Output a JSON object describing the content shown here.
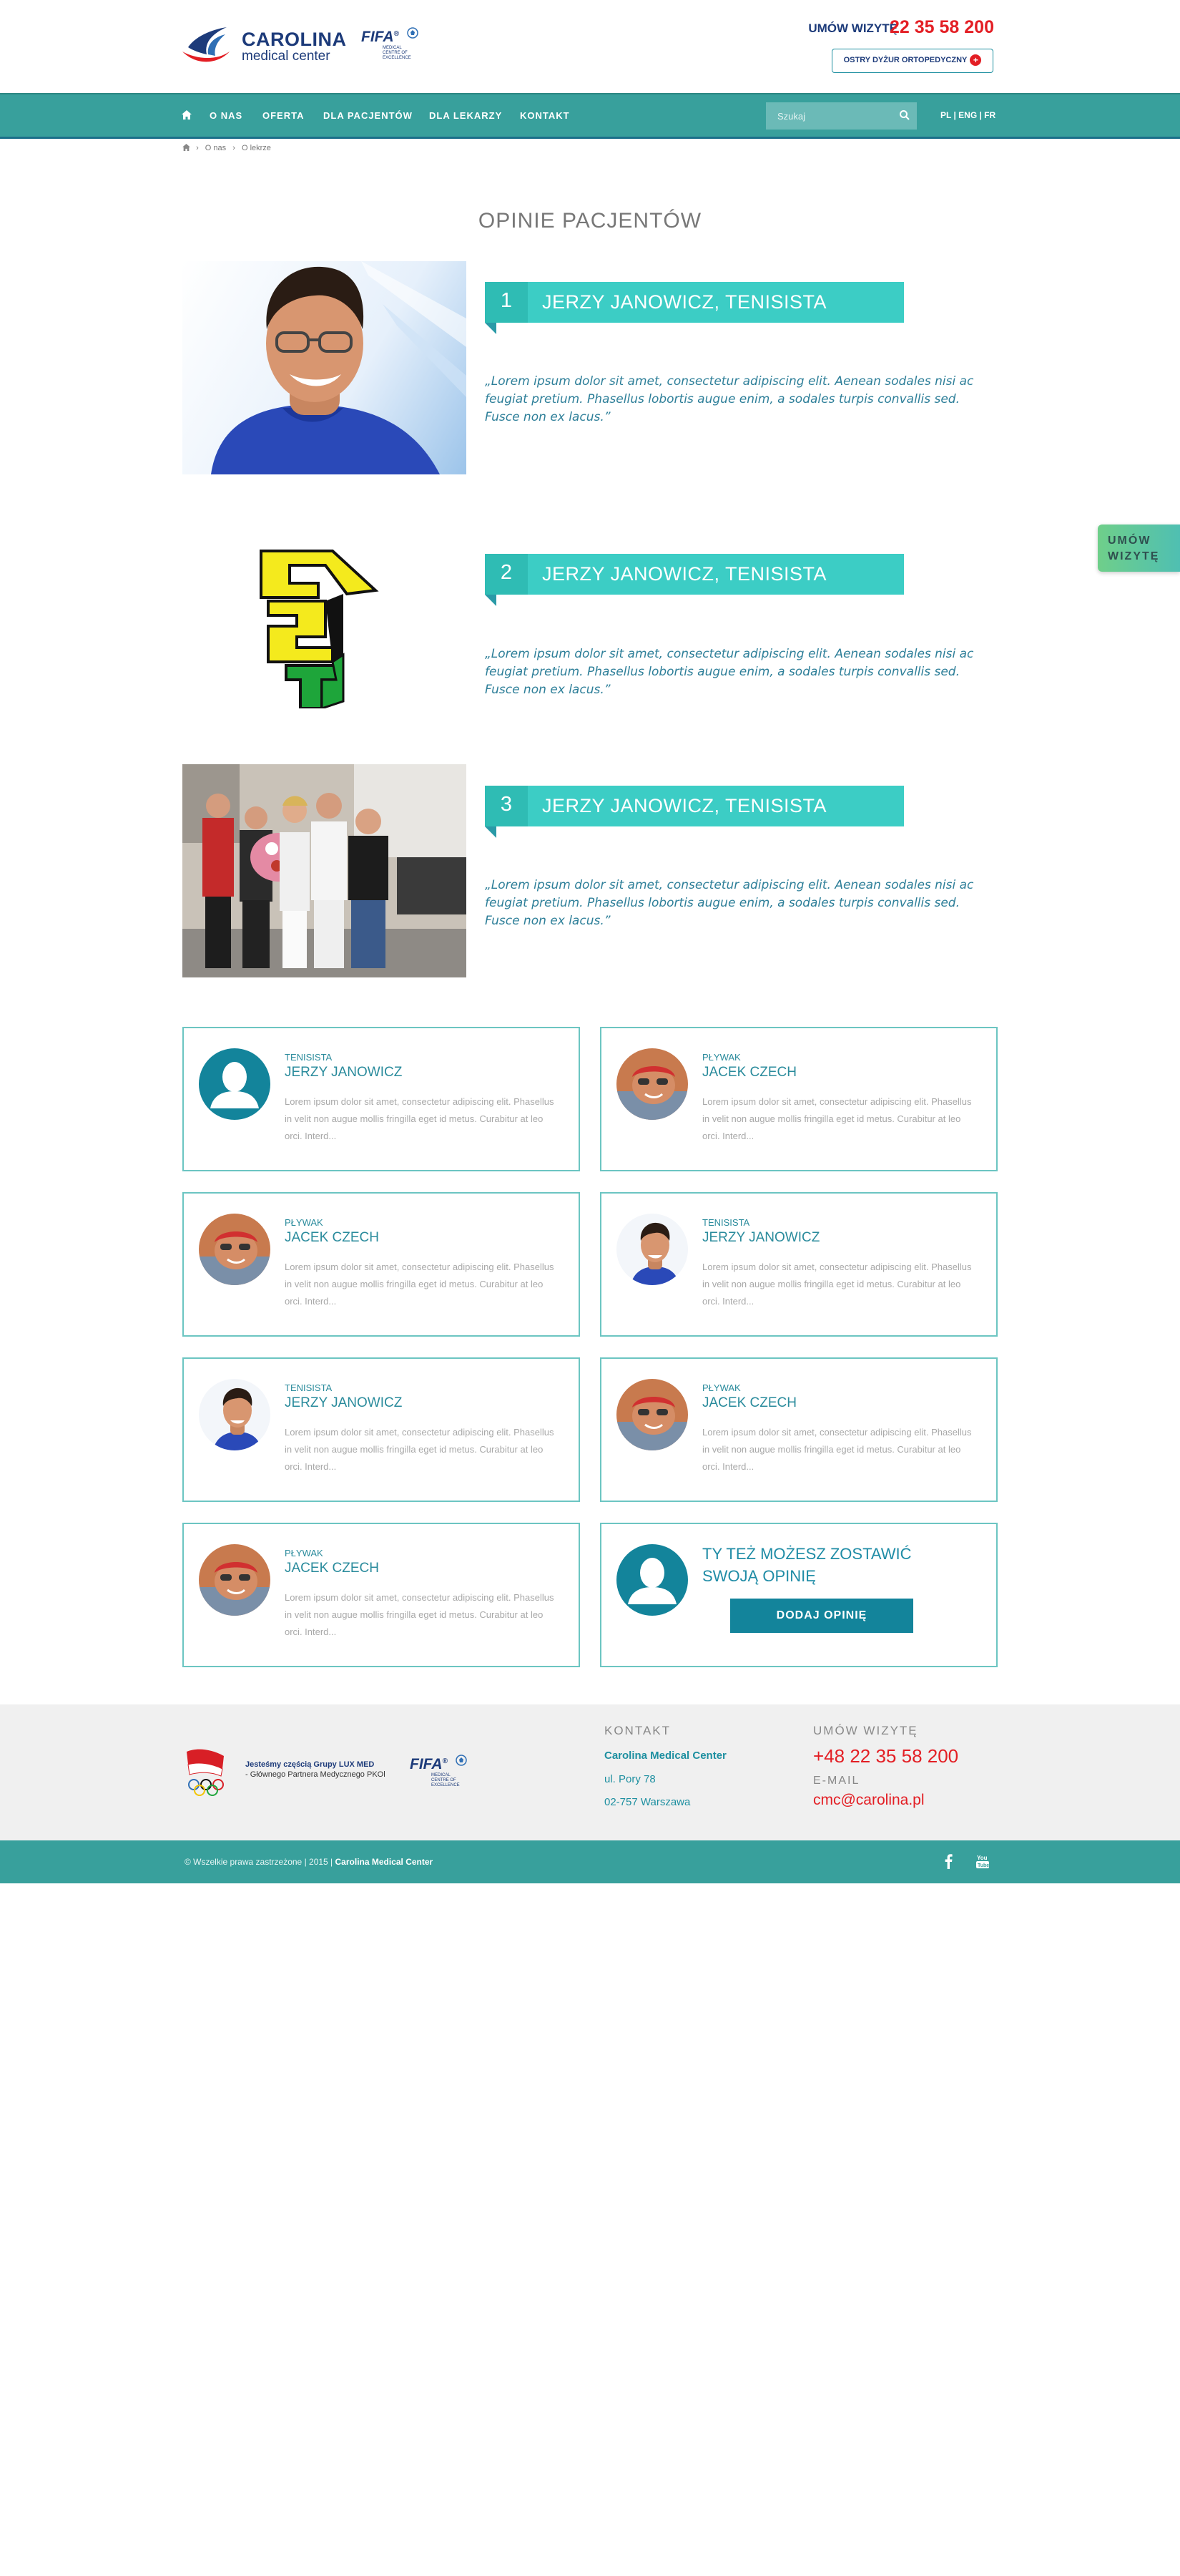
{
  "header": {
    "logo_name": "CAROLINA",
    "logo_sub": "medical center",
    "fifa_word": "FIFA",
    "fifa_sub": "MEDICAL CENTRE OF EXCELLENCE",
    "appointment_label": "UMÓW WIZYTĘ",
    "phone": "22 35 58 200",
    "emergency_label": "OSTRY DYŻUR ORTOPEDYCZNY"
  },
  "nav": {
    "items": [
      "O NAS",
      "OFERTA",
      "DLA PACJENTÓW",
      "DLA LEKARZY",
      "KONTAKT"
    ],
    "search_placeholder": "Szukaj",
    "languages": "PL | ENG | FR"
  },
  "breadcrumb": [
    "O nas",
    "O lekrze"
  ],
  "page_title": "OPINIE PACJENTÓW",
  "testimonials": [
    {
      "number": "1",
      "name": "JERZY JANOWICZ, TENISISTA",
      "quote": "„Lorem ipsum dolor sit amet, consectetur adipiscing elit. Aenean sodales nisi ac feugiat pretium. Phasellus lobortis augue enim, a sodales turpis convallis sed. Fusce non ex lacus.”"
    },
    {
      "number": "2",
      "name": "JERZY JANOWICZ, TENISISTA",
      "quote": "„Lorem ipsum dolor sit amet, consectetur adipiscing elit. Aenean sodales nisi ac feugiat pretium. Phasellus lobortis augue enim, a sodales turpis convallis sed. Fusce non ex lacus.”"
    },
    {
      "number": "3",
      "name": "JERZY JANOWICZ, TENISISTA",
      "quote": "„Lorem ipsum dolor sit amet, consectetur adipiscing elit. Aenean sodales nisi ac feugiat pretium. Phasellus lobortis augue enim, a sodales turpis convallis sed. Fusce non ex lacus.”"
    }
  ],
  "cards": [
    {
      "role": "TENISISTA",
      "name": "JERZY JANOWICZ",
      "text": "Lorem ipsum dolor sit amet, consectetur adipiscing elit. Phasellus in velit non augue mollis fringilla eget id metus. Curabitur at leo orci. Interd...",
      "avatar": "placeholder-icon"
    },
    {
      "role": "PŁYWAK",
      "name": "JACEK CZECH",
      "text": "Lorem ipsum dolor sit amet, consectetur adipiscing elit. Phasellus in velit non augue mollis fringilla eget id metus. Curabitur at leo orci. Interd...",
      "avatar": "swimmer-photo"
    },
    {
      "role": "PŁYWAK",
      "name": "JACEK CZECH",
      "text": "Lorem ipsum dolor sit amet, consectetur adipiscing elit. Phasellus in velit non augue mollis fringilla eget id metus. Curabitur at leo orci. Interd...",
      "avatar": "swimmer-photo"
    },
    {
      "role": "TENISISTA",
      "name": "JERZY JANOWICZ",
      "text": "Lorem ipsum dolor sit amet, consectetur adipiscing elit. Phasellus in velit non augue mollis fringilla eget id metus. Curabitur at leo orci. Interd...",
      "avatar": "tennis-photo"
    },
    {
      "role": "TENISISTA",
      "name": "JERZY JANOWICZ",
      "text": "Lorem ipsum dolor sit amet, consectetur adipiscing elit. Phasellus in velit non augue mollis fringilla eget id metus. Curabitur at leo orci. Interd...",
      "avatar": "tennis-photo"
    },
    {
      "role": "PŁYWAK",
      "name": "JACEK CZECH",
      "text": "Lorem ipsum dolor sit amet, consectetur adipiscing elit. Phasellus in velit non augue mollis fringilla eget id metus. Curabitur at leo orci. Interd...",
      "avatar": "swimmer-photo"
    },
    {
      "role": "PŁYWAK",
      "name": "JACEK CZECH",
      "text": "Lorem ipsum dolor sit amet, consectetur adipiscing elit. Phasellus in velit non augue mollis fringilla eget id metus. Curabitur at leo orci. Interd...",
      "avatar": "swimmer-photo"
    }
  ],
  "cta": {
    "title_line1": "TY TEŻ MOŻESZ ZOSTAWIĆ",
    "title_line2": "SWOJĄ OPINIĘ",
    "button": "DODAJ OPINIĘ"
  },
  "side_tab": {
    "line1": "UMÓW",
    "line2": "WIZYTĘ"
  },
  "footer": {
    "group_line1": "Jesteśmy częścią Grupy LUX MED",
    "group_line2": "- Głównego Partnera Medycznego PKOl",
    "contact_head": "KONTAKT",
    "company": "Carolina Medical Center",
    "street": "ul. Pory 78",
    "city": "02-757 Warszawa",
    "appointment_head": "UMÓW WIZYTĘ",
    "phone": "+48 22 35 58 200",
    "email_head": "E-MAIL",
    "email": "cmc@carolina.pl",
    "copyright": "© Wszelkie prawa zastrzeżone | 2015 |",
    "copyright_company": "Carolina Medical Center"
  },
  "colors": {
    "teal": "#38a09c",
    "accent": "#3ccdc5",
    "navy": "#1d3b7a",
    "red": "#e31e24"
  }
}
